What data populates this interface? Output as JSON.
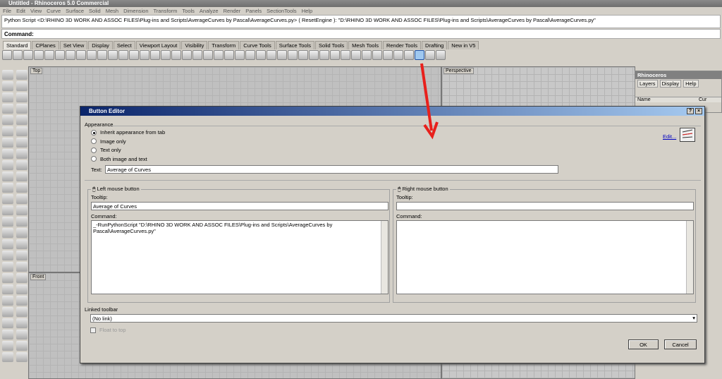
{
  "window": {
    "title": "Untitled - Rhinoceros 5.0 Commercial"
  },
  "menu": [
    "File",
    "Edit",
    "View",
    "Curve",
    "Surface",
    "Solid",
    "Mesh",
    "Dimension",
    "Transform",
    "Tools",
    "Analyze",
    "Render",
    "Panels",
    "SectionTools",
    "Help"
  ],
  "command_history": "Python Script <D:\\RHINO 3D WORK AND ASSOC FILES\\Plug-ins and Scripts\\AverageCurves by Pascal\\AverageCurves.py> ( ResetEngine ): \"D:\\RHINO 3D WORK AND ASSOC FILES\\Plug-ins and Scripts\\AverageCurves by Pascal\\AverageCurves.py\"",
  "command_label": "Command:",
  "tabs": [
    "Standard",
    "CPlanes",
    "Set View",
    "Display",
    "Select",
    "Viewport Layout",
    "Visibility",
    "Transform",
    "Curve Tools",
    "Surface Tools",
    "Solid Tools",
    "Mesh Tools",
    "Render Tools",
    "Drafting",
    "New in V5"
  ],
  "viewports": {
    "top": "Top",
    "perspective": "Perspective",
    "front": "Front"
  },
  "panel": {
    "title": "Rhinoceros",
    "tabs": [
      "Layers",
      "Display",
      "Help"
    ],
    "col_name": "Name",
    "col_current": "Cur"
  },
  "dialog": {
    "title": "Button Editor",
    "help": "?",
    "close": "×",
    "appearance_label": "Appearance",
    "options": [
      "Inherit appearance from tab",
      "Image only",
      "Text only",
      "Both image and text"
    ],
    "selected_option": 0,
    "text_label": "Text:",
    "text_value": "Average of Curves",
    "edit_link": "Edit...",
    "left": {
      "label": "Left mouse button",
      "tooltip_label": "Tooltip:",
      "tooltip_value": "Average of Curves",
      "command_label": "Command:",
      "command_value": "_-RunPythonScript \"D:\\RHINO 3D WORK AND ASSOC FILES\\Plug-ins and Scripts\\AverageCurves by Pascal\\AverageCurves.py\""
    },
    "right": {
      "label": "Right mouse button",
      "tooltip_label": "Tooltip:",
      "tooltip_value": "",
      "command_label": "Command:",
      "command_value": ""
    },
    "linked_label": "Linked toolbar",
    "linked_value": "(No link)",
    "float_label": "Float to top",
    "ok": "OK",
    "cancel": "Cancel"
  },
  "colors": {
    "arrow": "#e8201c",
    "dialog_title": "#0a246a"
  }
}
